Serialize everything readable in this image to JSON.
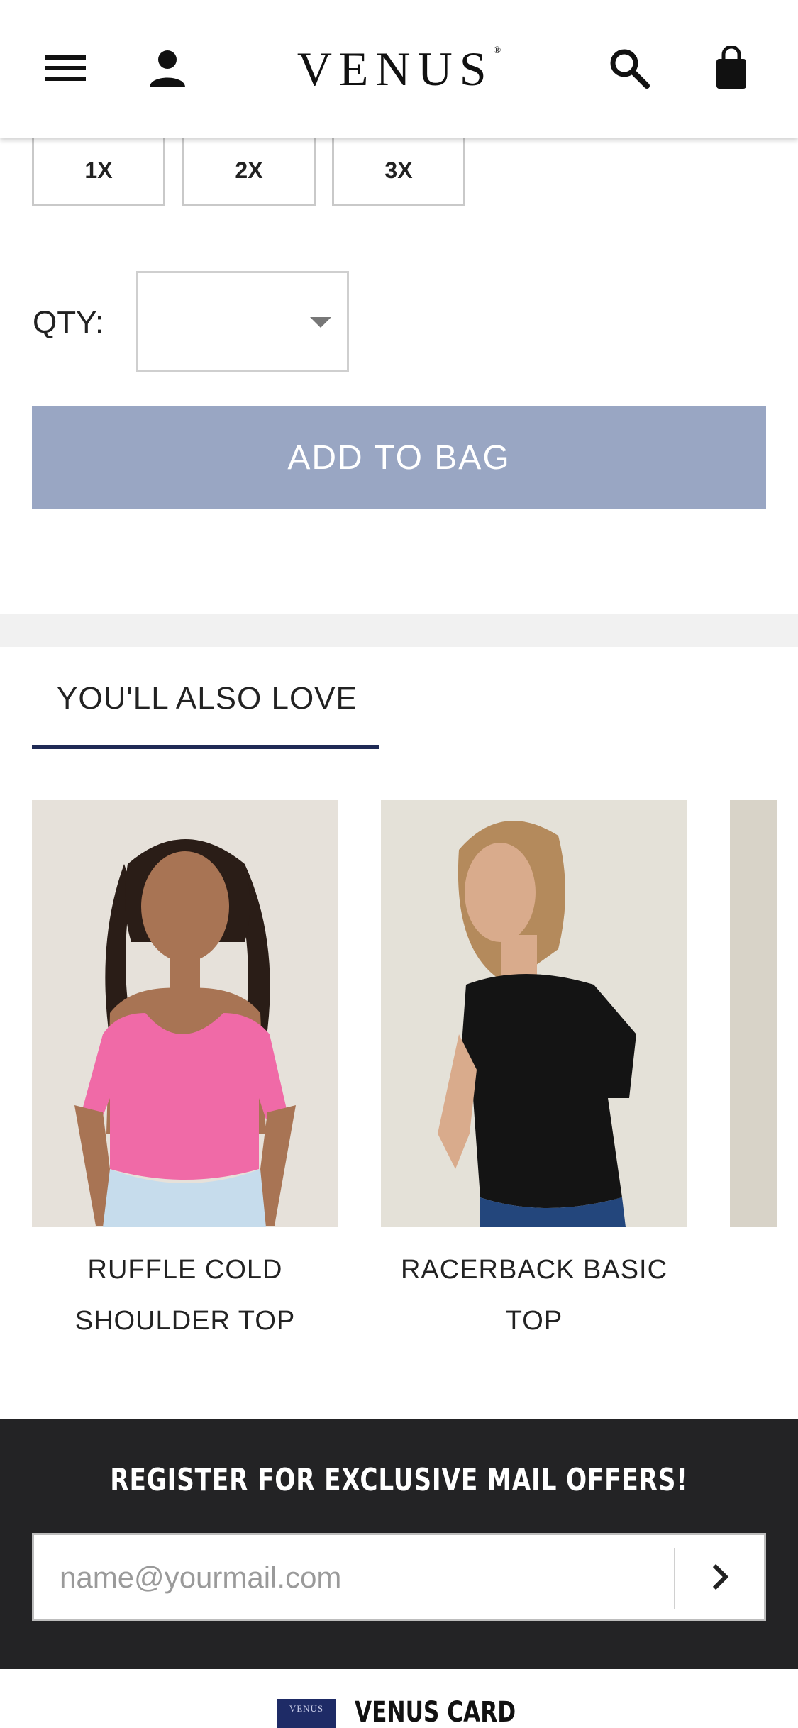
{
  "header": {
    "brand": "VENUS",
    "brand_mark": "®",
    "icons": [
      "menu-icon",
      "account-icon",
      "search-icon",
      "bag-icon"
    ]
  },
  "sizes": [
    "1X",
    "2X",
    "3X"
  ],
  "quantity": {
    "label": "QTY:",
    "selected": ""
  },
  "add_to_bag": "ADD TO BAG",
  "also_love": {
    "title": "YOU'LL ALSO LOVE",
    "products": [
      {
        "name_line1": "RUFFLE COLD",
        "name_line2": "SHOULDER TOP",
        "color": "#f06aa7"
      },
      {
        "name_line1": "RACERBACK BASIC",
        "name_line2": "TOP",
        "color": "#111111"
      }
    ]
  },
  "mail": {
    "title": "REGISTER FOR EXCLUSIVE MAIL OFFERS!",
    "placeholder": "name@yourmail.com"
  },
  "footer": {
    "card_logo": "VENUS",
    "card_label": "VENUS CARD"
  },
  "colors": {
    "add_to_bag_bg": "#99a6c3",
    "accent_underline": "#1f2a55",
    "mail_bg": "#232325"
  }
}
